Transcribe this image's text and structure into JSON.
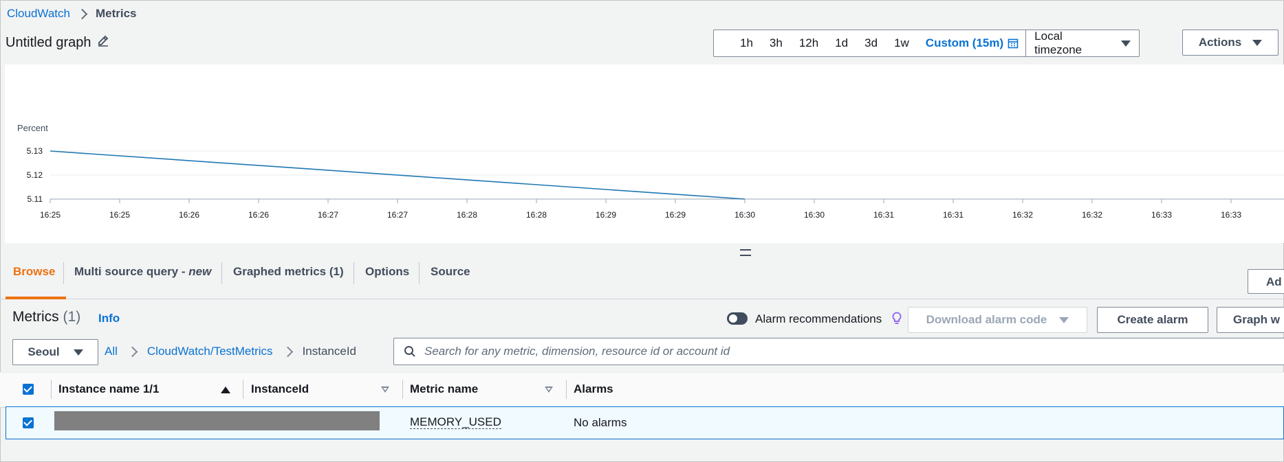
{
  "breadcrumb": {
    "root": "CloudWatch",
    "current": "Metrics"
  },
  "graph_title": "Untitled graph",
  "time_range": {
    "options": [
      "1h",
      "3h",
      "12h",
      "1d",
      "3d",
      "1w"
    ],
    "custom": "Custom (15m)",
    "timezone": "Local timezone"
  },
  "actions_label": "Actions",
  "chart_data": {
    "type": "line",
    "ylabel": "Percent",
    "yticks": [
      "5.13",
      "5.12",
      "5.11"
    ],
    "ylim": [
      5.11,
      5.13
    ],
    "xticks": [
      "16:25",
      "16:25",
      "16:26",
      "16:26",
      "16:27",
      "16:27",
      "16:28",
      "16:28",
      "16:29",
      "16:29",
      "16:30",
      "16:30",
      "16:31",
      "16:31",
      "16:32",
      "16:32",
      "16:33",
      "16:33"
    ],
    "series": [
      {
        "x": [
          "16:25",
          "16:30"
        ],
        "values": [
          5.13,
          5.11
        ],
        "color": "#1f77b4"
      }
    ],
    "grid": true
  },
  "tabs": {
    "browse": "Browse",
    "multi_source": "Multi source query - ",
    "multi_source_new": "new",
    "graphed": "Graphed metrics (1)",
    "options": "Options",
    "source": "Source",
    "add_label": "Ad"
  },
  "metrics": {
    "title": "Metrics",
    "count": "(1)",
    "info": "Info",
    "alarm_recommendations": "Alarm recommendations",
    "download_alarm_code": "Download alarm code",
    "create_alarm": "Create alarm",
    "graph_with": "Graph w",
    "region": "Seoul",
    "path": {
      "all": "All",
      "namespace": "CloudWatch/TestMetrics",
      "dimension": "InstanceId"
    },
    "search_placeholder": "Search for any metric, dimension, resource id or account id",
    "columns": {
      "instance_name": "Instance name 1/1",
      "instance_id": "InstanceId",
      "metric_name": "Metric name",
      "alarms": "Alarms"
    },
    "rows": [
      {
        "metric_name": "MEMORY_USED",
        "alarms": "No alarms"
      }
    ]
  }
}
